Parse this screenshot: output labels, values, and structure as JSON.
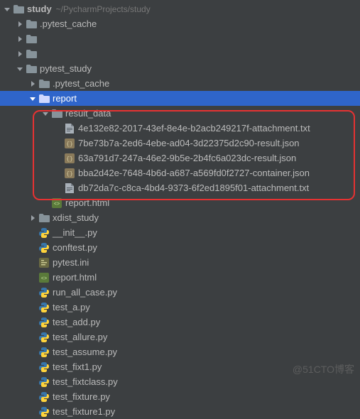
{
  "root": {
    "name": "study",
    "path": "~/PycharmProjects/study"
  },
  "nodes": [
    {
      "depth": 0,
      "arrow": "down",
      "icon": "folder-root",
      "label": "study",
      "bold": true,
      "path": "~/PycharmProjects/study",
      "interact": true
    },
    {
      "depth": 1,
      "arrow": "right",
      "icon": "folder",
      "label": ".pytest_cache",
      "interact": true
    },
    {
      "depth": 1,
      "arrow": "right",
      "icon": "folder",
      "label": "    ",
      "blur": true,
      "interact": true
    },
    {
      "depth": 1,
      "arrow": "right",
      "icon": "folder",
      "label": "       ",
      "blur": true,
      "interact": true
    },
    {
      "depth": 1,
      "arrow": "down",
      "icon": "folder",
      "label": "pytest_study",
      "interact": true
    },
    {
      "depth": 2,
      "arrow": "right",
      "icon": "folder",
      "label": ".pytest_cache",
      "interact": true
    },
    {
      "depth": 2,
      "arrow": "down",
      "icon": "folder",
      "label": "report",
      "selected": true,
      "interact": true
    },
    {
      "depth": 3,
      "arrow": "down",
      "icon": "folder",
      "label": "result_data",
      "interact": true
    },
    {
      "depth": 4,
      "arrow": "none",
      "icon": "txt",
      "label": "4e132e82-2017-43ef-8e4e-b2acb249217f-attachment.txt",
      "interact": true
    },
    {
      "depth": 4,
      "arrow": "none",
      "icon": "json",
      "label": "7be73b7a-2ed6-4ebe-ad04-3d22375d2c90-result.json",
      "interact": true
    },
    {
      "depth": 4,
      "arrow": "none",
      "icon": "json",
      "label": "63a791d7-247a-46e2-9b5e-2b4fc6a023dc-result.json",
      "interact": true
    },
    {
      "depth": 4,
      "arrow": "none",
      "icon": "json",
      "label": "bba2d42e-7648-4b6d-a687-a569fd0f2727-container.json",
      "interact": true
    },
    {
      "depth": 4,
      "arrow": "none",
      "icon": "txt",
      "label": "db72da7c-c8ca-4bd4-9373-6f2ed1895f01-attachment.txt",
      "interact": true
    },
    {
      "depth": 3,
      "arrow": "none",
      "icon": "html",
      "label": "report.html",
      "interact": true
    },
    {
      "depth": 2,
      "arrow": "right",
      "icon": "folder",
      "label": "xdist_study",
      "interact": true
    },
    {
      "depth": 2,
      "arrow": "none",
      "icon": "py",
      "label": "__init__.py",
      "interact": true
    },
    {
      "depth": 2,
      "arrow": "none",
      "icon": "py",
      "label": "conftest.py",
      "interact": true
    },
    {
      "depth": 2,
      "arrow": "none",
      "icon": "ini",
      "label": "pytest.ini",
      "interact": true
    },
    {
      "depth": 2,
      "arrow": "none",
      "icon": "html",
      "label": "report.html",
      "interact": true
    },
    {
      "depth": 2,
      "arrow": "none",
      "icon": "py",
      "label": "run_all_case.py",
      "interact": true
    },
    {
      "depth": 2,
      "arrow": "none",
      "icon": "py",
      "label": "test_a.py",
      "interact": true
    },
    {
      "depth": 2,
      "arrow": "none",
      "icon": "py",
      "label": "test_add.py",
      "interact": true
    },
    {
      "depth": 2,
      "arrow": "none",
      "icon": "py",
      "label": "test_allure.py",
      "interact": true
    },
    {
      "depth": 2,
      "arrow": "none",
      "icon": "py",
      "label": "test_assume.py",
      "interact": true
    },
    {
      "depth": 2,
      "arrow": "none",
      "icon": "py",
      "label": "test_fixt1.py",
      "interact": true
    },
    {
      "depth": 2,
      "arrow": "none",
      "icon": "py",
      "label": "test_fixtclass.py",
      "interact": true
    },
    {
      "depth": 2,
      "arrow": "none",
      "icon": "py",
      "label": "test_fixture.py",
      "interact": true
    },
    {
      "depth": 2,
      "arrow": "none",
      "icon": "py",
      "label": "test_fixture1.py",
      "interact": true
    }
  ],
  "watermark": "@51CTO博客"
}
